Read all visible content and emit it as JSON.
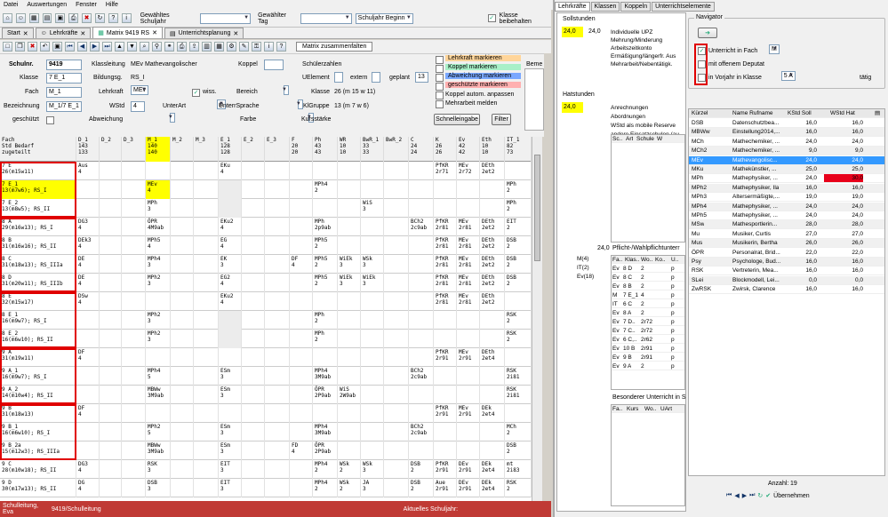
{
  "menu": [
    "Datei",
    "Auswertungen",
    "Fenster",
    "Hilfe"
  ],
  "toolbar": {
    "schuljahr_label": "Gewähltes Schuljahr",
    "tag_label": "Gewählter Tag",
    "schuljahr_beginn": "Schuljahr Beginn",
    "klasse_beibehalten": "Klasse beibehalten"
  },
  "tabs": [
    "Start",
    "Lehrkräfte",
    "Matrix 9419 RS",
    "Unterrichtsplanung"
  ],
  "matrix_btn": "Matrix zusammenfalten",
  "form": {
    "schulnr_label": "Schulnr.",
    "schulnr": "9419",
    "klassleitung_label": "Klassleitung",
    "klassleitung": "MEv Mathevangolischer",
    "koppel_label": "Koppel",
    "klasse_label": "Klasse",
    "klasse": "7 E_1",
    "bildungsg_label": "Bildungsg.",
    "bildungsg": "RS_I",
    "fach_label": "Fach",
    "fach": "M_1",
    "lehrkraft_label": "Lehrkraft",
    "lehrkraft": "MEv",
    "wiss": "wiss.",
    "bereich_label": "Bereich",
    "bezeichnung_label": "Bezeichnung",
    "bezeichnung": "M_1/7 E_1",
    "wstd_label": "WStd",
    "wstd": "4",
    "unterart_label": "UnterArt",
    "unterart": "p",
    "unterrsprache_label": "UnterrSprache",
    "kl_gruppe_label": "KlGruppe",
    "kl_gruppe": "13 (m 7 w 6)",
    "geschuetzt_label": "geschützt",
    "abweichung_label": "Abweichung",
    "farbe_label": "Farbe",
    "kursstaerke_label": "Kursstärke",
    "schuelerzahlen_label": "Schülerzahlen",
    "uelement_label": "UElement",
    "extern_label": "extern",
    "geplant_label": "geplant",
    "geplant": "13",
    "klasse2_label": "Klasse",
    "klasse2": "26 (m 15 w 11)",
    "lehrkraft_markieren": "Lehrkraft markieren",
    "koppel_markieren": "Koppel markieren",
    "abweichung_markieren": "Abweichung markieren",
    "geschuetzte_markieren": "geschützte markieren",
    "koppel_autom": "Koppel autom. anpassen",
    "mehrarbeit": "Mehrarbeit melden",
    "schnelleingabe": "Schnelleingabe",
    "filter": "Filter",
    "bemerk": "Beme"
  },
  "grid_header": [
    "Fach\nStd Bedarf\nzugeteilt",
    "D_1\n143\n133",
    "D_2",
    "D_3",
    "M_1\n140\n140",
    "M_2",
    "M_3",
    "E_1\n128\n128",
    "E_2",
    "E_3",
    "F\n20\n20",
    "Ph\n43\n43",
    "WR\n10\n10",
    "BwR_1\n33\n33",
    "BwR_2",
    "C\n24\n24",
    "K\n26\n26",
    "Ev\n42\n42",
    "Eth\n10\n10",
    "IT_1\n82\n73"
  ],
  "grid_rows": [
    [
      "7 E\n26(m15w11)",
      "Aus\n4",
      "",
      "",
      "",
      "",
      "",
      "EKu\n4",
      "",
      "",
      "",
      "",
      "",
      "",
      "",
      "",
      "PfKR\n2r71",
      "MEv\n2r72",
      "DEth\n2et2",
      ""
    ],
    [
      "7 E_1\n13(m7w6); RS_I",
      "",
      "",
      "",
      "MEv\n4",
      "",
      "",
      "",
      "",
      "",
      "",
      "MPh4\n2",
      "",
      "",
      "",
      "",
      "",
      "",
      "",
      "MPh\n2"
    ],
    [
      "7 E_2\n13(m8w5); RS_II",
      "",
      "",
      "",
      "MPh\n3",
      "",
      "",
      "",
      "",
      "",
      "",
      "",
      "",
      "WiS\n3",
      "",
      "",
      "",
      "",
      "",
      "MPh\n2"
    ],
    [
      "8 A\n29(m16w13); RS_I",
      "DG3\n4",
      "",
      "",
      "ÖPR\n4M9ab",
      "",
      "",
      "EKu2\n4",
      "",
      "",
      "",
      "MPh\n2p9ab",
      "",
      "",
      "",
      "BCh2\n2c9ab",
      "PfKR\n2r81",
      "MEv\n2r81",
      "DEth\n2et2",
      "EIT\n2"
    ],
    [
      "8 B\n31(m16w16); RS_II",
      "DEk3\n4",
      "",
      "",
      "MPh5\n4",
      "",
      "",
      "EG\n4",
      "",
      "",
      "",
      "MPh5\n2",
      "",
      "",
      "",
      "",
      "PfKR\n2r81",
      "MEv\n2r81",
      "DEth\n2et2",
      "DSB\n2"
    ],
    [
      "8 C\n31(m18w13); RS_IIIa",
      "DE\n4",
      "",
      "",
      "MPh4\n3",
      "",
      "",
      "EK\n3",
      "",
      "",
      "DF\n4",
      "MPh5\n2",
      "WiEk\n3",
      "WSk\n3",
      "",
      "",
      "PfKR\n2r81",
      "MEv\n2r81",
      "DEth\n2et2",
      "DSB\n2"
    ],
    [
      "8 D\n31(m20w11); RS_IIIb",
      "DE\n4",
      "",
      "",
      "MPh2\n3",
      "",
      "",
      "EG2\n4",
      "",
      "",
      "",
      "MPh5\n2",
      "WiEk\n3",
      "WiEk\n3",
      "",
      "",
      "PfKR\n2r81",
      "MEv\n2r81",
      "DEth\n2et2",
      "DSB\n2"
    ],
    [
      "8 E\n32(m15w17)",
      "DSw\n4",
      "",
      "",
      "",
      "",
      "",
      "EKu2\n4",
      "",
      "",
      "",
      "",
      "",
      "",
      "",
      "",
      "PfKR\n2r81",
      "MEv\n2r81",
      "DEth\n2et2",
      ""
    ],
    [
      "8 E_1\n16(m9w7); RS_I",
      "",
      "",
      "",
      "MPh2\n3",
      "",
      "",
      "",
      "",
      "",
      "",
      "MPh\n2",
      "",
      "",
      "",
      "",
      "",
      "",
      "",
      "RSK\n2"
    ],
    [
      "8 E_2\n16(m6w10); RS_II",
      "",
      "",
      "",
      "MPh2\n3",
      "",
      "",
      "",
      "",
      "",
      "",
      "MPh\n2",
      "",
      "",
      "",
      "",
      "",
      "",
      "",
      "RSK\n2"
    ],
    [
      "9 A\n31(m19w11)",
      "DF\n4",
      "",
      "",
      "",
      "",
      "",
      "",
      "",
      "",
      "",
      "",
      "",
      "",
      "",
      "",
      "PfKR\n2r91",
      "MEv\n2r91",
      "DEth\n2et4",
      ""
    ],
    [
      "9 A_1\n16(m9w7); RS_I",
      "",
      "",
      "",
      "MPh4\n5",
      "",
      "",
      "ESm\n3",
      "",
      "",
      "",
      "MPh4\n3M9ab",
      "",
      "",
      "",
      "BCh2\n2c9ab",
      "",
      "",
      "",
      "RSK\n2i81"
    ],
    [
      "9 A_2\n14(m10w4); RS_II",
      "",
      "",
      "",
      "MBWw\n3M9ab",
      "",
      "",
      "ESm\n3",
      "",
      "",
      "",
      "ÖPR\n2P9ab",
      "WiS\n2W9ab",
      "",
      "",
      "",
      "",
      "",
      "",
      "RSK\n2i81"
    ],
    [
      "9 B\n31(m18w13)",
      "DF\n4",
      "",
      "",
      "",
      "",
      "",
      "",
      "",
      "",
      "",
      "",
      "",
      "",
      "",
      "",
      "PfKR\n2r91",
      "MEv\n2r91",
      "DEk\n2et4",
      ""
    ],
    [
      "9 B_1\n16(m6w10); RS_I",
      "",
      "",
      "",
      "MPh2\n5",
      "",
      "",
      "ESm\n3",
      "",
      "",
      "",
      "MPh4\n3M9ab",
      "",
      "",
      "",
      "BCh2\n2c9ab",
      "",
      "",
      "",
      "MCh\n2"
    ],
    [
      "9 B_2a\n15(m12w3); RS_IIIa",
      "",
      "",
      "",
      "MBWw\n3M9ab",
      "",
      "",
      "ESm\n3",
      "",
      "",
      "FD\n4",
      "ÖPR\n2P9ab",
      "",
      "",
      "",
      "",
      "",
      "",
      "",
      "DSB\n2"
    ],
    [
      "9 C\n28(m10w18); RS_II",
      "DG3\n4",
      "",
      "",
      "RSK\n3",
      "",
      "",
      "EIT\n3",
      "",
      "",
      "",
      "MPh4\n2",
      "WSk\n2",
      "WSk\n3",
      "",
      "DSB\n2",
      "PfKR\n2r91",
      "DEv\n2r91",
      "DEk\n2et4",
      "mt\n2i83"
    ],
    [
      "9 D\n30(m17w13); RS_II",
      "DG\n4",
      "",
      "",
      "DSB\n3",
      "",
      "",
      "EIT\n3",
      "",
      "",
      "",
      "MPh4\n2",
      "WSk\n2",
      "JA\n3",
      "",
      "DSB\n2",
      "Aue\n2r91",
      "DEv\n2r91",
      "DEk\n2et4",
      "RSK\n2"
    ]
  ],
  "statusbar": {
    "left": "Schulleitung, Eva",
    "mid": "9419/Schulleitung",
    "right": "Aktuelles Schuljahr:"
  },
  "right": {
    "tabs": [
      "Lehrkräfte",
      "Klassen",
      "Koppeln",
      "Unterrichtselemente"
    ],
    "sollstunden_label": "Sollstunden",
    "soll_value": "24,0",
    "soll_number": "24,0",
    "soll_items": [
      "Individuelle UPZ",
      "Mehrung/Minderung",
      "Arbeitszeitkonto",
      "Ermäßigung/längerfr. Aus",
      "Mehrarbeit/Nebentätigk."
    ],
    "hatstunden_label": "Hatstunden",
    "hat_value": "24,0",
    "hat_items": [
      "Anrechnungen",
      "Abordnungen",
      "WStd als mobile Reserve",
      "andere Einsatzschulen (au"
    ],
    "small_tbl_header": [
      "Sc..",
      "Art",
      "Schule",
      "W"
    ],
    "pflicht_value": "24,0",
    "pflicht_label": "Pflicht-/Wahlpflichtunterr",
    "left_list": [
      "M(4)",
      "IT(2)",
      "Ev(18)"
    ],
    "pflicht_header": [
      "Fa..",
      "Klas..",
      "Wo..",
      "Ko..",
      "U.."
    ],
    "pflicht_rows": [
      [
        "Ev",
        "8 D",
        "2",
        "p"
      ],
      [
        "Ev",
        "8 C",
        "2",
        "p"
      ],
      [
        "Ev",
        "8 B",
        "2",
        "p"
      ],
      [
        "M",
        "7 E_1",
        "4",
        "p"
      ],
      [
        "IT",
        "6 C",
        "2",
        "p"
      ],
      [
        "Ev",
        "8 A",
        "2",
        "p"
      ],
      [
        "Ev",
        "7 D..",
        "2r72",
        "p"
      ],
      [
        "Ev",
        "7 C..",
        "2r72",
        "p"
      ],
      [
        "Ev",
        "6 C,..",
        "2r62",
        "p"
      ],
      [
        "Ev",
        "10 B",
        "2r91",
        "p"
      ],
      [
        "Ev",
        "9 B",
        "2r91",
        "p"
      ],
      [
        "Ev",
        "9 A",
        "2",
        "p"
      ]
    ],
    "besonderer_label": "Besonderer Unterricht in S",
    "bes_header": [
      "Fa..",
      "Kurs",
      "Wo..",
      "UArt"
    ],
    "navigator_label": "Navigator",
    "nav_options": [
      {
        "label": "Unterricht in Fach",
        "checked": true,
        "value": "M"
      },
      {
        "label": "mit offenem Deputat",
        "checked": false,
        "value": ""
      },
      {
        "label": "in Vorjahr in Klasse",
        "checked": false,
        "value": "5 A",
        "extra": "tätig"
      }
    ],
    "lt_header": [
      "Kürzel",
      "Name Rufname",
      "KStd Soll",
      "WStd Hat"
    ],
    "lt_rows": [
      [
        "DSB",
        "Datenschutzbea...",
        "16,0",
        "16,0"
      ],
      [
        "MBWw",
        "Einstellung2014,...",
        "16,0",
        "16,0"
      ],
      [
        "MCh",
        "Mathechemiker, ...",
        "24,0",
        "24,0"
      ],
      [
        "MCh2",
        "Mathechemiker, ...",
        "9,0",
        "9,0"
      ],
      [
        "MEv",
        "Mathevangolisc...",
        "24,0",
        "24,0"
      ],
      [
        "MKu",
        "Mathekünstler, ...",
        "25,0",
        "25,0"
      ],
      [
        "MPh",
        "Mathephysiker, ...",
        "24,0",
        "30,0"
      ],
      [
        "MPh2",
        "Mathephysiker, Ila",
        "16,0",
        "16,0"
      ],
      [
        "MPh3",
        "Altersermäßigte,...",
        "19,0",
        "19,0"
      ],
      [
        "MPh4",
        "Mathephysiker, ...",
        "24,0",
        "24,0"
      ],
      [
        "MPh5",
        "Mathephysiker, ...",
        "24,0",
        "24,0"
      ],
      [
        "MSw",
        "Mathesportlerin...",
        "28,0",
        "28,0"
      ],
      [
        "Mu",
        "Musiker, Curtis",
        "27,0",
        "27,0"
      ],
      [
        "Mus",
        "Musikerin, Bertha",
        "26,0",
        "26,0"
      ],
      [
        "ÖPR",
        "Personalrat, Brid...",
        "22,0",
        "22,0"
      ],
      [
        "Psy",
        "Psychologe, Bud...",
        "16,0",
        "16,0"
      ],
      [
        "RSK",
        "Vertreterin, Mea...",
        "16,0",
        "16,0"
      ],
      [
        "SLei",
        "Blockmodell, Lei...",
        "0,0",
        "0,0"
      ],
      [
        "ZwRSK",
        "Zwirsk, Clarence",
        "16,0",
        "16,0"
      ]
    ],
    "anzahl_label": "Anzahl:",
    "anzahl": "19",
    "uebernehmen": "Übernehmen"
  },
  "colors": {
    "highlight_yellow": "#ffff00",
    "selected_row": "#3399ff",
    "over_red": "#e8001a",
    "status_red": "#c03a35",
    "nav_box": "#e00000"
  }
}
